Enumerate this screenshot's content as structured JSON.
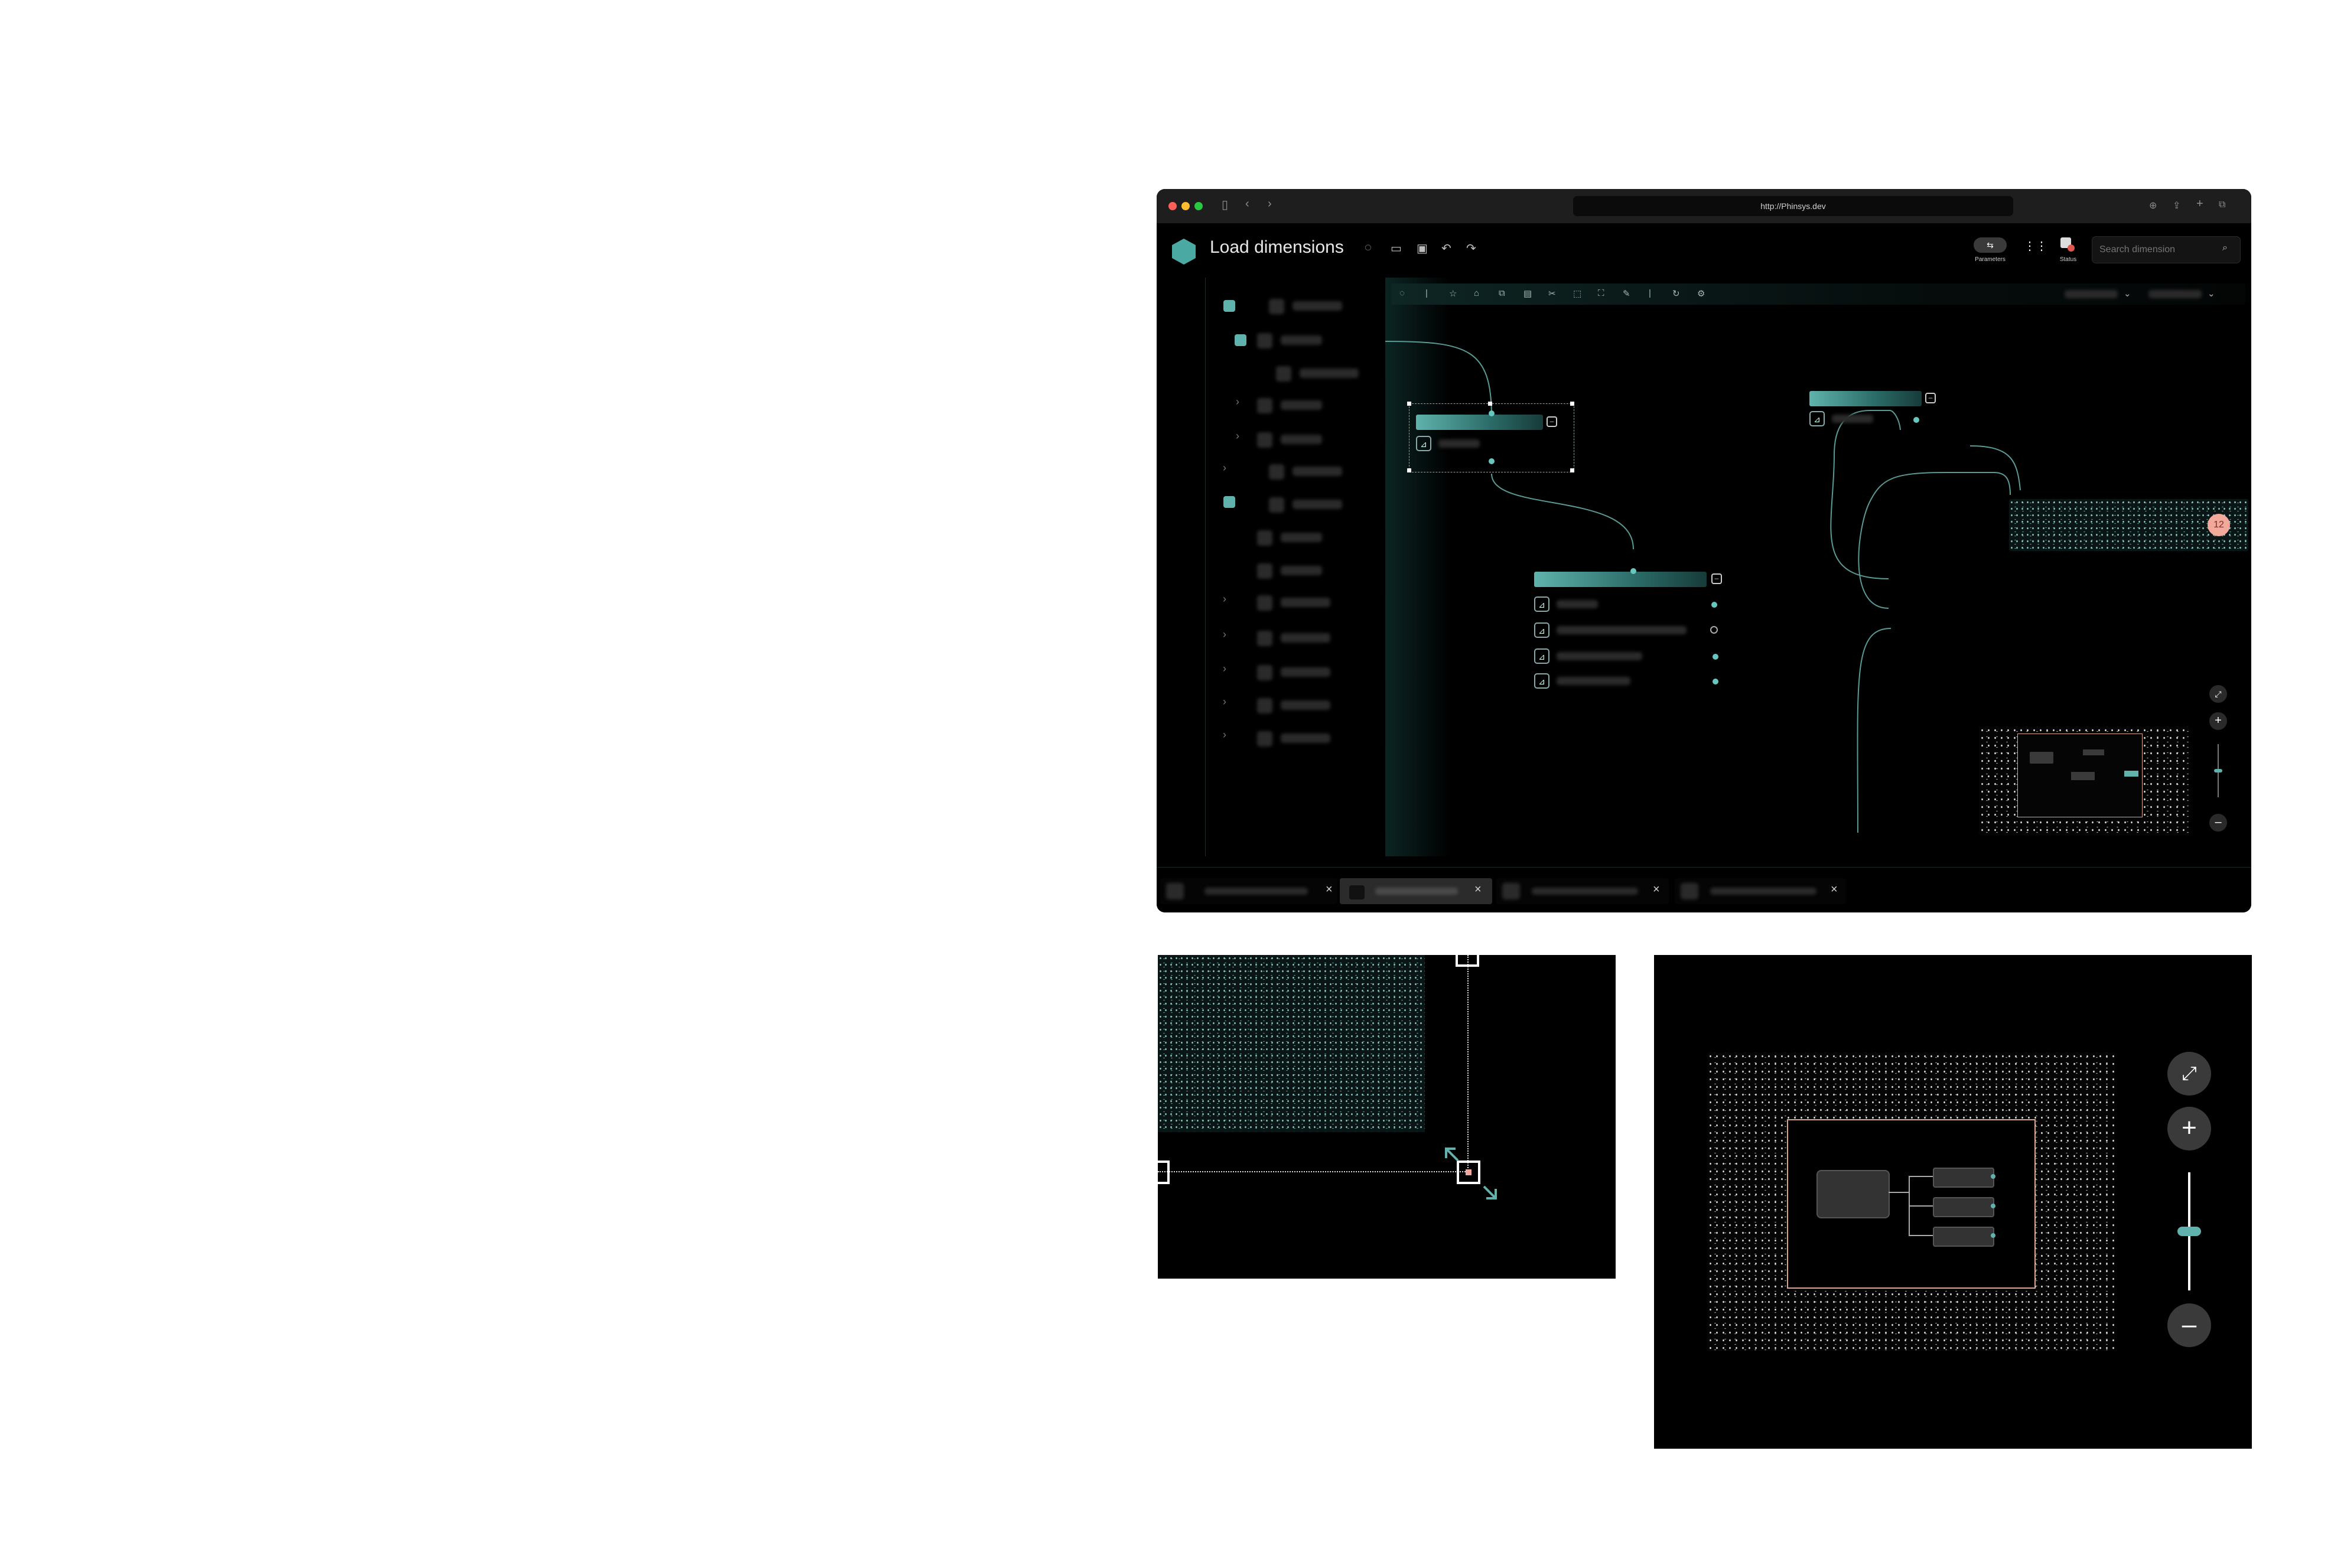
{
  "browser": {
    "url": "http://Phinsys.dev"
  },
  "app": {
    "title": "Load dimensions"
  },
  "header": {
    "parameters_label": "Parameters",
    "status_label": "Status",
    "search_placeholder": "Search dimension"
  },
  "canvas": {
    "badge_count": "12"
  },
  "colors": {
    "accent": "#5fb3ac",
    "badge": "#f2a89a",
    "background": "#000000",
    "minimap_frame": "#d8a58f"
  },
  "icons": [
    "back-icon",
    "forward-icon",
    "sidebar-icon",
    "chat-icon",
    "folder-icon",
    "save-icon",
    "undo-icon",
    "redo-icon",
    "parameters-icon",
    "apps-grid-icon",
    "status-icon",
    "search-icon",
    "fit-screen-icon",
    "zoom-in-icon",
    "zoom-out-icon",
    "close-icon",
    "collapse-icon",
    "star-icon",
    "copy-icon",
    "scissors-icon",
    "refresh-icon",
    "settings-icon"
  ]
}
